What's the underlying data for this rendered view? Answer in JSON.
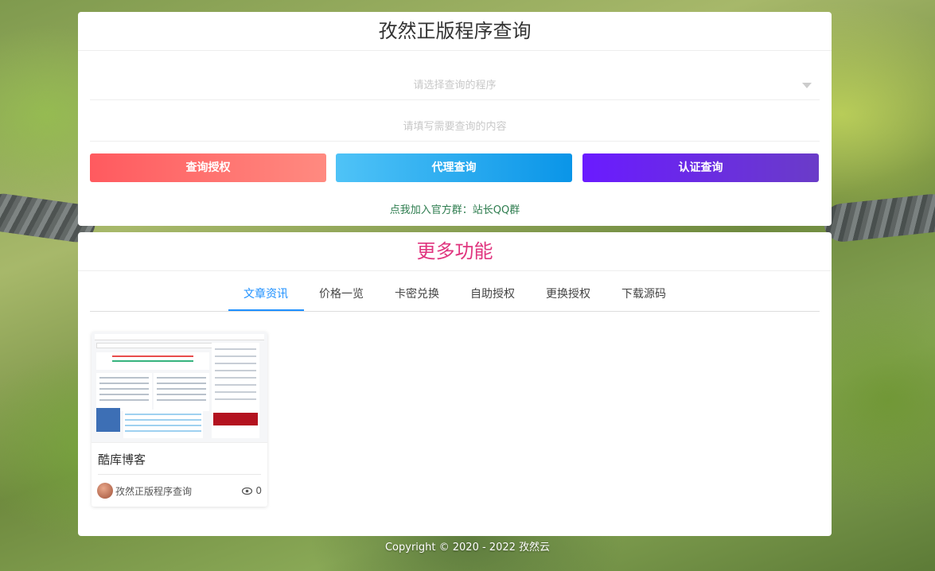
{
  "query_card": {
    "title": "孜然正版程序查询",
    "select_placeholder": "请选择查询的程序",
    "input_placeholder": "请填写需要查询的内容",
    "buttons": {
      "auth": "查询授权",
      "agent": "代理查询",
      "cert": "认证查询"
    },
    "join_text": "点我加入官方群：站长QQ群"
  },
  "more_card": {
    "title": "更多功能",
    "tabs": [
      {
        "label": "文章资讯",
        "active": true
      },
      {
        "label": "价格一览",
        "active": false
      },
      {
        "label": "卡密兑换",
        "active": false
      },
      {
        "label": "自助授权",
        "active": false
      },
      {
        "label": "更换授权",
        "active": false
      },
      {
        "label": "下载源码",
        "active": false
      }
    ],
    "posts": [
      {
        "title": "酷库博客",
        "author": "孜然正版程序查询",
        "views": "0"
      }
    ]
  },
  "footer": {
    "copyright": "Copyright © 2020 - 2022 孜然云"
  },
  "colors": {
    "accent_blue": "#1e90ff",
    "title_pink": "#e0357f",
    "join_green": "#2e7d4f"
  }
}
